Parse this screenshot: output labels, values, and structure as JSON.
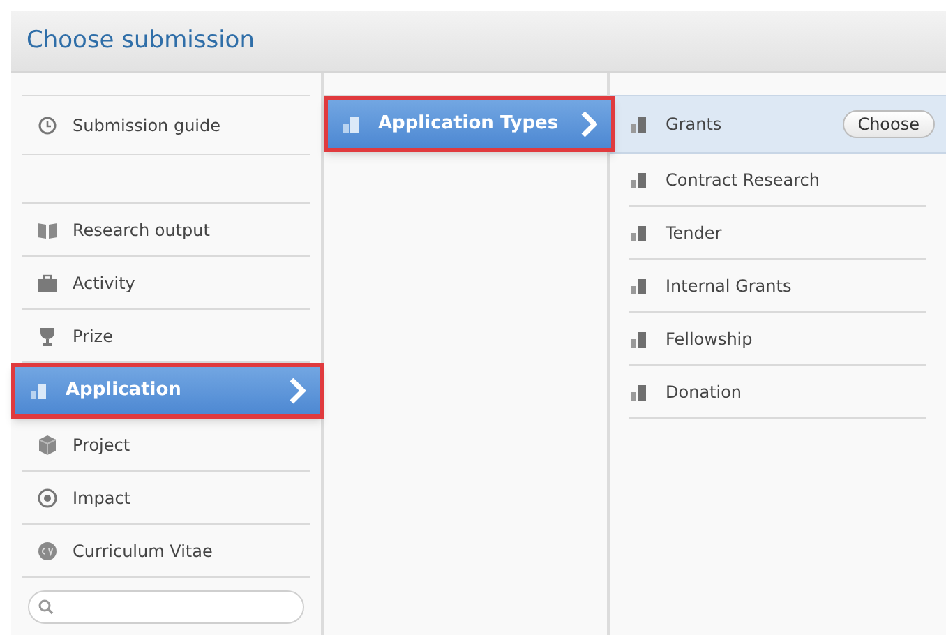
{
  "dialog": {
    "title": "Choose submission"
  },
  "guide_items": [
    {
      "label": "Submission guide",
      "kind": "clock",
      "selected": false
    }
  ],
  "categories": [
    {
      "label": "Research output",
      "kind": "book",
      "selected": false
    },
    {
      "label": "Activity",
      "kind": "briefcase",
      "selected": false
    },
    {
      "label": "Prize",
      "kind": "trophy",
      "selected": false
    },
    {
      "label": "Application",
      "kind": "chart",
      "selected": true
    },
    {
      "label": "Project",
      "kind": "cube",
      "selected": false
    },
    {
      "label": "Impact",
      "kind": "target",
      "selected": false
    },
    {
      "label": "Curriculum Vitae",
      "kind": "cv",
      "selected": false
    }
  ],
  "subcategories": [
    {
      "label": "Application Types",
      "kind": "chart",
      "selected": true
    }
  ],
  "types": [
    {
      "label": "Grants",
      "selected": true,
      "action": "Choose"
    },
    {
      "label": "Contract Research",
      "selected": false
    },
    {
      "label": "Tender",
      "selected": false
    },
    {
      "label": "Internal Grants",
      "selected": false
    },
    {
      "label": "Fellowship",
      "selected": false
    },
    {
      "label": "Donation",
      "selected": false
    }
  ]
}
